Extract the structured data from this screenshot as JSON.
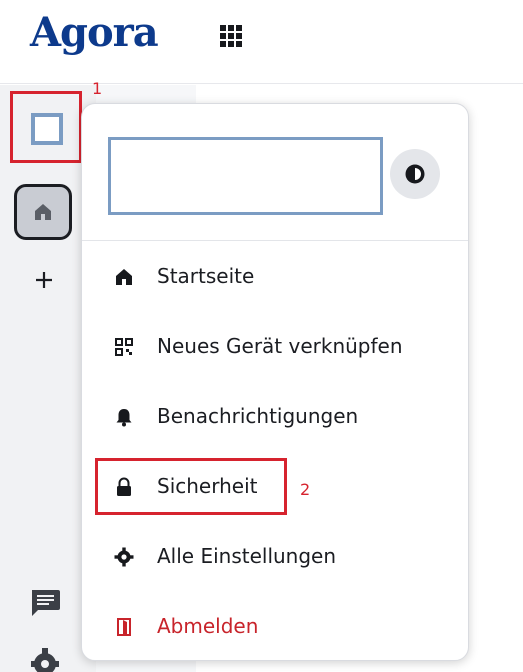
{
  "header": {
    "logo_text": "Agora",
    "apps_icon": "apps-grid-icon"
  },
  "rail": {
    "home_icon": "home-icon",
    "add_icon": "plus-icon",
    "chat_icon": "chat-icon",
    "settings_icon": "gear-icon"
  },
  "menu": {
    "theme_icon": "theme-toggle-icon",
    "items": [
      {
        "label": "Startseite",
        "icon": "home-icon"
      },
      {
        "label": "Neues Gerät verknüpfen",
        "icon": "qr-code-icon"
      },
      {
        "label": "Benachrichtigungen",
        "icon": "bell-icon"
      },
      {
        "label": "Sicherheit",
        "icon": "lock-icon"
      },
      {
        "label": "Alle Einstellungen",
        "icon": "gear-icon"
      },
      {
        "label": "Abmelden",
        "icon": "sign-out-icon"
      }
    ]
  },
  "annotations": {
    "label_1": "1",
    "label_2": "2"
  },
  "colors": {
    "brand": "#0d3a8c",
    "annotation": "#d6232e",
    "danger": "#c8242b",
    "placeholder_border": "#7b9cc3"
  }
}
